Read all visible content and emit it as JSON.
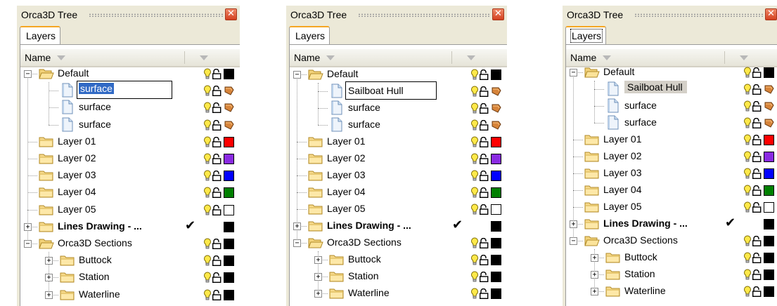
{
  "panels": [
    {
      "title": "Orca3D Tree",
      "tab": "Layers",
      "column": "Name",
      "layers": {
        "default": "Default",
        "surface1": "surface",
        "surface2": "surface",
        "surface3": "surface",
        "l01": "Layer 01",
        "l02": "Layer 02",
        "l03": "Layer 03",
        "l04": "Layer 04",
        "l05": "Layer 05",
        "lines": "Lines Drawing - ...",
        "sections": "Orca3D Sections",
        "buttock": "Buttock",
        "station": "Station",
        "waterline": "Waterline"
      }
    },
    {
      "title": "Orca3D Tree",
      "tab": "Layers",
      "column": "Name",
      "layers": {
        "default": "Default",
        "surface1": "Sailboat Hull",
        "surface2": "surface",
        "surface3": "surface",
        "l01": "Layer 01",
        "l02": "Layer 02",
        "l03": "Layer 03",
        "l04": "Layer 04",
        "l05": "Layer 05",
        "lines": "Lines Drawing - ...",
        "sections": "Orca3D Sections",
        "buttock": "Buttock",
        "station": "Station",
        "waterline": "Waterline"
      }
    },
    {
      "title": "Orca3D Tree",
      "tab": "Layers",
      "column": "Name",
      "layers": {
        "default": "Default",
        "surface1": "Sailboat Hull",
        "surface2": "surface",
        "surface3": "surface",
        "l01": "Layer 01",
        "l02": "Layer 02",
        "l03": "Layer 03",
        "l04": "Layer 04",
        "l05": "Layer 05",
        "lines": "Lines Drawing - ...",
        "sections": "Orca3D Sections",
        "buttock": "Buttock",
        "station": "Station",
        "waterline": "Waterline"
      }
    }
  ],
  "icons": {
    "visibility": "lightbulb-icon",
    "lock": "padlock-open-icon",
    "material": "material-icon",
    "visible_check": "checkmark-icon",
    "close": "close-icon"
  },
  "colors": {
    "default": "#000000",
    "l01": "#ff0000",
    "l02": "#8a2be2",
    "l03": "#0000ff",
    "l04": "#008000",
    "l05": "#ffffff",
    "lines": "#000000",
    "sections": "#000000",
    "selection": "#316ac5",
    "close_button": "#d3401f",
    "tab_accent": "#f5a623"
  }
}
